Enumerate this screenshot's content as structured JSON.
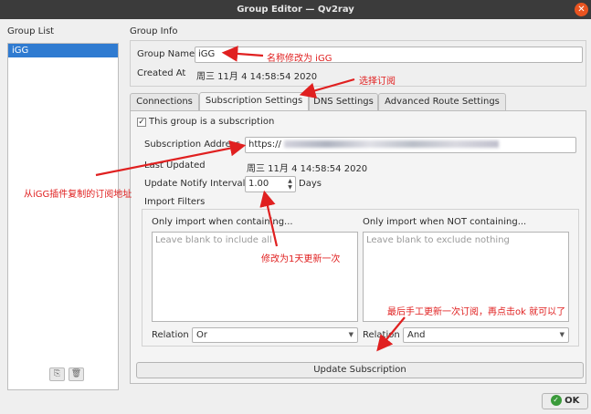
{
  "window": {
    "title": "Group Editor — Qv2ray",
    "close_glyph": "✕"
  },
  "group_list": {
    "title": "Group List",
    "items": [
      "iGG"
    ],
    "add_glyph": "⎘",
    "delete_glyph": "🗑"
  },
  "group_info": {
    "title": "Group Info",
    "name_label": "Group Name",
    "name_value": "iGG",
    "created_label": "Created At",
    "created_value": "周三 11月 4 14:58:54 2020"
  },
  "tabs": [
    "Connections",
    "Subscription Settings",
    "DNS Settings",
    "Advanced Route Settings"
  ],
  "subscription": {
    "is_subscription_label": "This group is a subscription",
    "is_subscription_checked": "✓",
    "address_label": "Subscription Address",
    "address_value": "https://",
    "last_updated_label": "Last Updated",
    "last_updated_value": "周三 11月 4 14:58:54 2020",
    "interval_label": "Update Notify Interval",
    "interval_value": "1.00",
    "interval_unit": "Days",
    "import_filters_title": "Import Filters",
    "include_title": "Only import when containing...",
    "include_placeholder": "Leave blank to include all",
    "exclude_title": "Only import when NOT containing...",
    "exclude_placeholder": "Leave blank to exclude nothing",
    "relation_label": "Relation",
    "relation_include_value": "Or",
    "relation_exclude_value": "And",
    "update_button": "Update Subscription"
  },
  "ok_button": {
    "label": "OK",
    "check_glyph": "✓"
  },
  "annotations": {
    "rename": "名称修改为 iGG",
    "select_tab": "选择订阅",
    "copy_address": "从iGG插件复制的订阅地址",
    "interval": "修改为1天更新一次",
    "finally": "最后手工更新一次订阅，再点击ok 就可以了"
  },
  "colors": {
    "annotation": "#e02020",
    "selection": "#2f7bd1",
    "titlebar": "#3b3b3b",
    "close": "#e95420"
  }
}
